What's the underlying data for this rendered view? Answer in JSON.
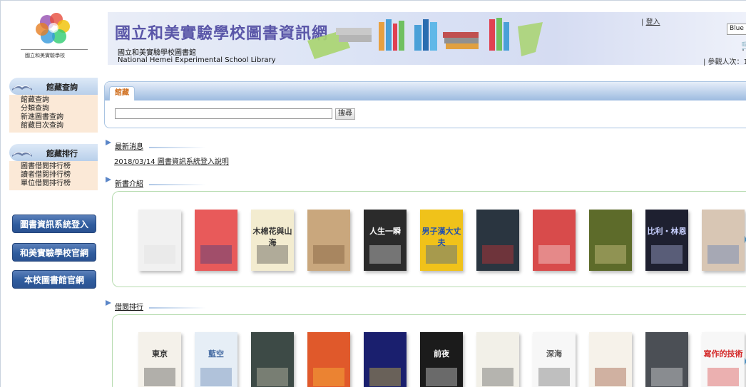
{
  "header": {
    "title": "國立和美實驗學校圖書資訊網",
    "subtitle_zh": "國立和美實驗學校圖書館",
    "subtitle_en": "National Hemei Experimental School Library",
    "login_prefix": "| ",
    "login": "登入",
    "theme": "Blue",
    "visitors": "| 參觀人次：1",
    "logo_text": "國立和美實驗學校"
  },
  "sidebar": {
    "collection_head": "館藏查詢",
    "collection_items": [
      "館藏查詢",
      "分類查詢",
      "新進圖書查詢",
      "館藏目次查詢"
    ],
    "ranking_head": "館藏排行",
    "ranking_items": [
      "圖書借閱排行榜",
      "讀者借閱排行榜",
      "單位借閱排行榜"
    ],
    "buttons": [
      "圖書資訊系統登入",
      "和美實驗學校官網",
      "本校圖書館官網"
    ]
  },
  "search": {
    "tab": "館藏",
    "input_value": "",
    "button": "搜尋"
  },
  "sections": {
    "news_title": "最新消息",
    "news_items": [
      "2018/03/14 圖書資訊系統登入說明"
    ],
    "new_books_title": "新書介紹",
    "borrow_rank_title": "借閱排行"
  },
  "colors": {
    "accent_blue": "#2f5c9e",
    "tab_orange": "#d07020",
    "carousel_border": "#b7dcb0",
    "sidebar_list_bg": "#fbe9d7"
  },
  "new_books": [
    {
      "bg": "#f1f1f1",
      "fg": "#dddddd",
      "title": ""
    },
    {
      "bg": "#e85a5a",
      "fg": "#1e3a8a",
      "title": ""
    },
    {
      "bg": "#f3ecd0",
      "fg": "#333333",
      "title": "木棉花與山海"
    },
    {
      "bg": "#c9a77d",
      "fg": "#6b4b2a",
      "title": ""
    },
    {
      "bg": "#2b2b2b",
      "fg": "#ffffff",
      "title": "人生一瞬"
    },
    {
      "bg": "#f0c21a",
      "fg": "#1f4fae",
      "title": "男子漢大丈夫"
    },
    {
      "bg": "#2a3540",
      "fg": "#e33",
      "title": ""
    },
    {
      "bg": "#d84b4b",
      "fg": "#ffffff",
      "title": ""
    },
    {
      "bg": "#5d6b2a",
      "fg": "#f0e0a0",
      "title": ""
    },
    {
      "bg": "#1e2030",
      "fg": "#c8d0ff",
      "title": "比利・林恩"
    },
    {
      "bg": "#d8c6b4",
      "fg": "#4a6fb5",
      "title": ""
    }
  ],
  "rank_books": [
    {
      "bg": "#f4f1ea",
      "fg": "#333333",
      "title": "東京"
    },
    {
      "bg": "#e6eef6",
      "fg": "#4a6fa5",
      "title": "藍空"
    },
    {
      "bg": "#3d4a46",
      "fg": "#e8e0c8",
      "title": ""
    },
    {
      "bg": "#e0592b",
      "fg": "#ffd23f",
      "title": ""
    },
    {
      "bg": "#1a1f6e",
      "fg": "#ffdd33",
      "title": ""
    },
    {
      "bg": "#1b1b1b",
      "fg": "#ffffff",
      "title": "前夜"
    },
    {
      "bg": "#f2f0e8",
      "fg": "#444444",
      "title": ""
    },
    {
      "bg": "#f7f7f7",
      "fg": "#555555",
      "title": "深海"
    },
    {
      "bg": "#f6f2ea",
      "fg": "#8a3a1a",
      "title": ""
    },
    {
      "bg": "#4b4f55",
      "fg": "#ffffff",
      "title": ""
    },
    {
      "bg": "#f7f7f7",
      "fg": "#d42a2a",
      "title": "寫作的技術"
    }
  ]
}
